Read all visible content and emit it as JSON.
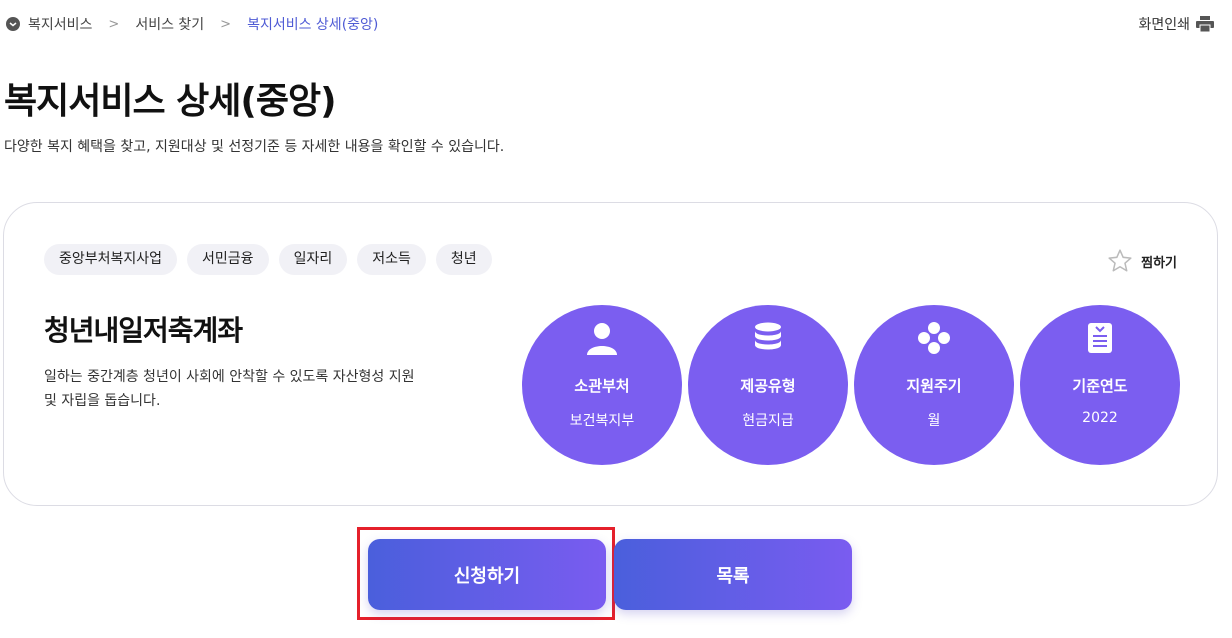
{
  "breadcrumb": {
    "items": [
      "복지서비스",
      "서비스 찾기",
      "복지서비스 상세(중앙)"
    ],
    "separator": ">"
  },
  "print_label": "화면인쇄",
  "page": {
    "title": "복지서비스 상세(중앙)",
    "description": "다양한 복지 혜택을 찾고, 지원대상 및 선정기준 등 자세한 내용을 확인할 수 있습니다."
  },
  "service": {
    "tags": [
      "중앙부처복지사업",
      "서민금융",
      "일자리",
      "저소득",
      "청년"
    ],
    "favorite_label": "찜하기",
    "title": "청년내일저축계좌",
    "description": "일하는 중간계층 청년이 사회에 안착할 수 있도록 자산형성 지원 및 자립을 돕습니다.",
    "info": [
      {
        "icon": "person-icon",
        "label": "소관부처",
        "value": "보건복지부"
      },
      {
        "icon": "coin-stack-icon",
        "label": "제공유형",
        "value": "현금지급"
      },
      {
        "icon": "cycle-dots-icon",
        "label": "지원주기",
        "value": "월"
      },
      {
        "icon": "clipboard-icon",
        "label": "기준연도",
        "value": "2022"
      }
    ]
  },
  "buttons": {
    "apply_label": "신청하기",
    "list_label": "목록"
  },
  "colors": {
    "accent": "#7b5ef0",
    "gradient_start": "#4a5fdc",
    "gradient_end": "#7a5cf0",
    "breadcrumb_current": "#4f5bd5",
    "highlight": "#e5202b"
  }
}
